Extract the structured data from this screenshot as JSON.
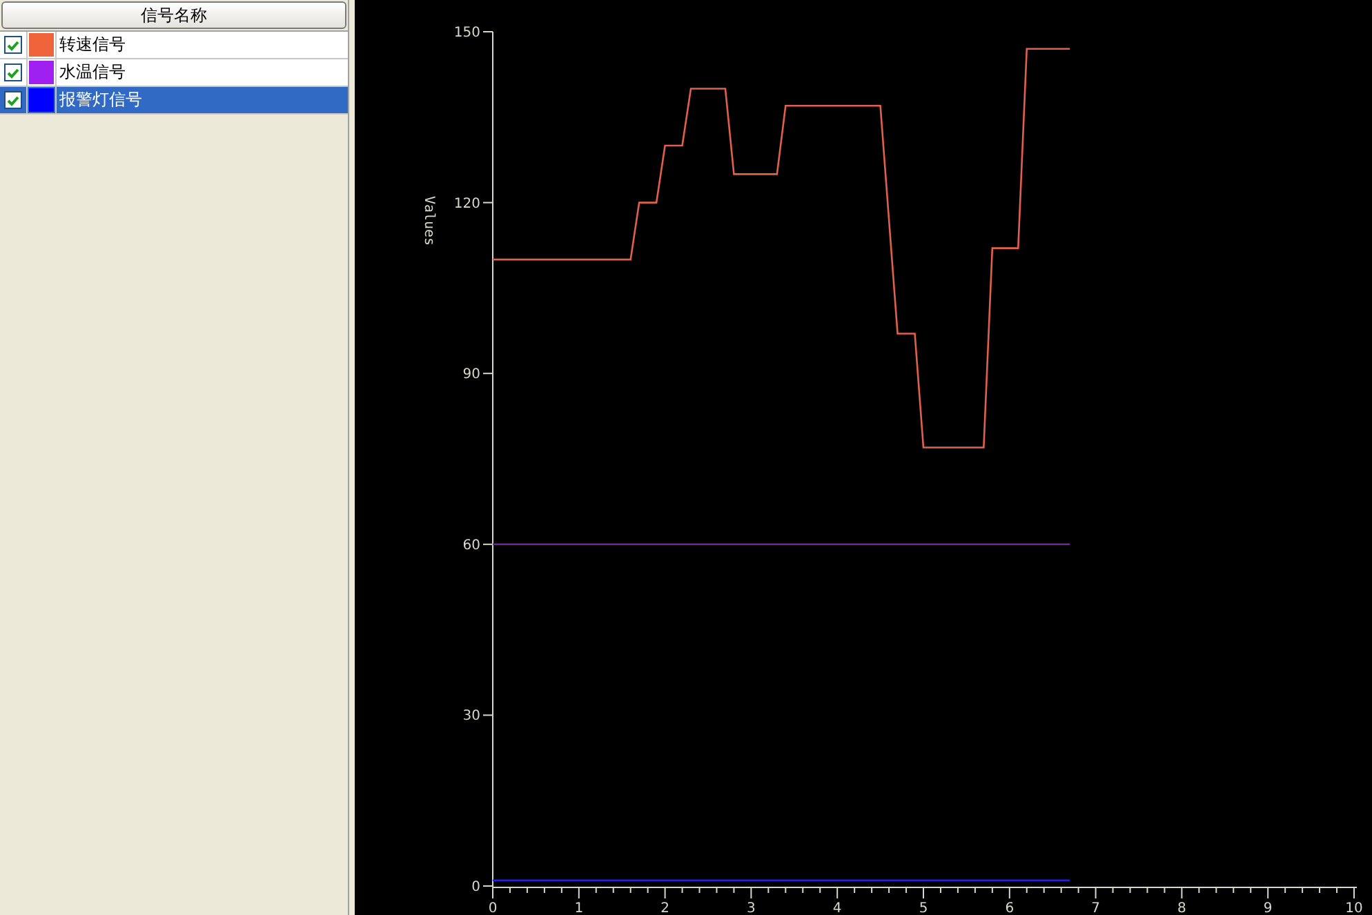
{
  "signal_panel": {
    "header": "信号名称",
    "signals": [
      {
        "checked": true,
        "color": "#f0643c",
        "name": "转速信号",
        "selected": false
      },
      {
        "checked": true,
        "color": "#a020f0",
        "name": "水温信号",
        "selected": false
      },
      {
        "checked": true,
        "color": "#0000ff",
        "name": "报警灯信号",
        "selected": true
      }
    ]
  },
  "chart": {
    "chart_data": {
      "type": "line",
      "ylabel": "Values",
      "x": [
        0,
        1.6,
        1.7,
        1.9,
        2.0,
        2.2,
        2.3,
        2.7,
        2.8,
        3.3,
        3.4,
        4.5,
        4.7,
        4.9,
        5.0,
        5.7,
        5.8,
        6.1,
        6.2,
        6.7
      ],
      "series": [
        {
          "color": "#e0604a",
          "values": [
            110,
            110,
            120,
            120,
            130,
            130,
            140,
            140,
            125,
            125,
            137,
            137,
            97,
            97,
            77,
            77,
            112,
            112,
            147,
            147
          ]
        },
        {
          "color": "#6a2a9a",
          "values": [
            60,
            60,
            60,
            60,
            60,
            60,
            60,
            60,
            60,
            60,
            60,
            60,
            60,
            60,
            60,
            60,
            60,
            60,
            60,
            60
          ]
        },
        {
          "color": "#2020e0",
          "values": [
            1,
            1,
            1,
            1,
            1,
            1,
            1,
            1,
            1,
            1,
            1,
            1,
            1,
            1,
            1,
            1,
            1,
            1,
            1,
            1
          ]
        }
      ],
      "xlim": [
        0,
        10
      ],
      "ylim": [
        0,
        150
      ],
      "xticks": [
        0,
        1,
        2,
        3,
        4,
        5,
        6,
        7,
        8,
        9,
        10
      ],
      "yticks": [
        0,
        30,
        60,
        90,
        120,
        150
      ]
    }
  }
}
